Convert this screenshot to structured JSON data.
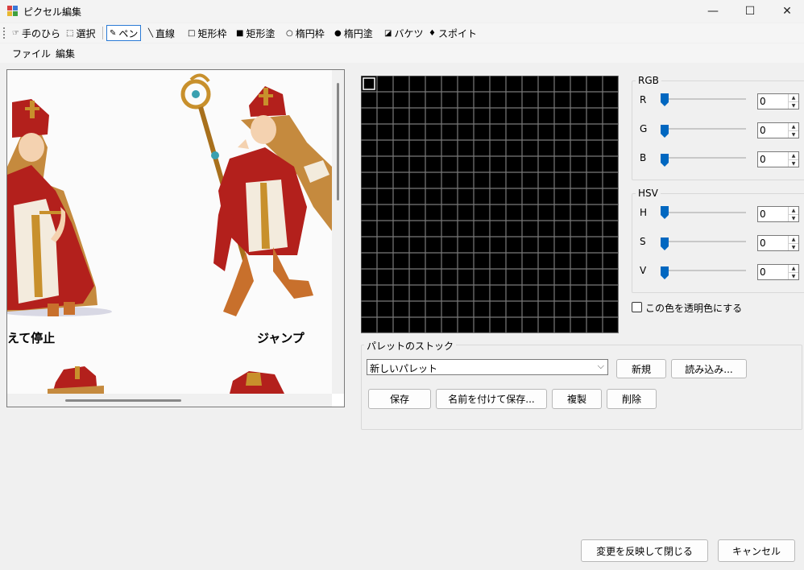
{
  "window": {
    "title": "ピクセル編集",
    "controls": [
      "—",
      "☐",
      "✕"
    ]
  },
  "toolbar": {
    "tools": [
      {
        "icon": "hand-icon",
        "glyph": "☞",
        "label": "手のひら",
        "active": false
      },
      {
        "icon": "select-icon",
        "glyph": "⬚",
        "label": "選択",
        "active": false
      },
      {
        "icon": "pen-icon",
        "glyph": "✎",
        "label": "ペン",
        "active": true
      },
      {
        "icon": "line-icon",
        "glyph": "╲",
        "label": "直線",
        "active": false
      },
      {
        "icon": "rect-outline-icon",
        "glyph": "□",
        "label": "矩形枠",
        "active": false
      },
      {
        "icon": "rect-fill-icon",
        "glyph": "■",
        "label": "矩形塗",
        "active": false
      },
      {
        "icon": "ellipse-outline-icon",
        "glyph": "○",
        "label": "楕円枠",
        "active": false
      },
      {
        "icon": "ellipse-fill-icon",
        "glyph": "●",
        "label": "楕円塗",
        "active": false
      },
      {
        "icon": "bucket-icon",
        "glyph": "◪",
        "label": "バケツ",
        "active": false
      },
      {
        "icon": "eyedropper-icon",
        "glyph": "♦",
        "label": "スポイト",
        "active": false
      }
    ]
  },
  "menu": {
    "file": "ファイル",
    "edit": "編集"
  },
  "preview": {
    "caption_left": "えて停止",
    "caption_right": "ジャンプ"
  },
  "rgb": {
    "legend": "RGB",
    "rows": [
      {
        "label": "R",
        "value": "0"
      },
      {
        "label": "G",
        "value": "0"
      },
      {
        "label": "B",
        "value": "0"
      }
    ]
  },
  "hsv": {
    "legend": "HSV",
    "rows": [
      {
        "label": "H",
        "value": "0"
      },
      {
        "label": "S",
        "value": "0"
      },
      {
        "label": "V",
        "value": "0"
      }
    ]
  },
  "transparent": {
    "label": "この色を透明色にする",
    "checked": false
  },
  "palette": {
    "legend": "パレットのストック",
    "selected": "新しいパレット",
    "new_label": "新規",
    "load_label": "読み込み...",
    "save_label": "保存",
    "save_as_label": "名前を付けて保存...",
    "duplicate_label": "複製",
    "delete_label": "削除"
  },
  "footer": {
    "apply_close_label": "変更を反映して閉じる",
    "cancel_label": "キャンセル"
  },
  "colors": {
    "accent": "#0067c0",
    "grid_line": "#7a7a7a",
    "grid_fill": "#000000",
    "robe_red": "#b3201c",
    "robe_white": "#f3ebdd",
    "gold": "#c8902c",
    "hair": "#c58a3e"
  }
}
